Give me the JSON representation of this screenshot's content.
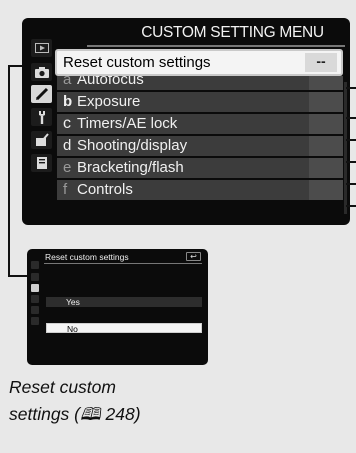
{
  "menu": {
    "title": "CUSTOM SETTING MENU",
    "selected_row": {
      "label": "Reset custom settings",
      "value": "--"
    },
    "items": [
      {
        "key": "a",
        "label": "Autofocus"
      },
      {
        "key": "b",
        "label": "Exposure"
      },
      {
        "key": "c",
        "label": "Timers/AE lock"
      },
      {
        "key": "d",
        "label": "Shooting/display"
      },
      {
        "key": "e",
        "label": "Bracketing/flash"
      },
      {
        "key": "f",
        "label": "Controls"
      }
    ]
  },
  "submenu": {
    "title": "Reset custom settings",
    "back_symbol": "↩",
    "options": [
      "Yes",
      "No"
    ],
    "selected": "No"
  },
  "caption": {
    "line1": "Reset custom",
    "line2": "settings (🕮 248)"
  },
  "icons": [
    "playback-menu-icon",
    "photo-shooting-menu-icon",
    "custom-setting-menu-icon",
    "setup-menu-icon",
    "retouch-menu-icon",
    "my-menu-icon"
  ]
}
